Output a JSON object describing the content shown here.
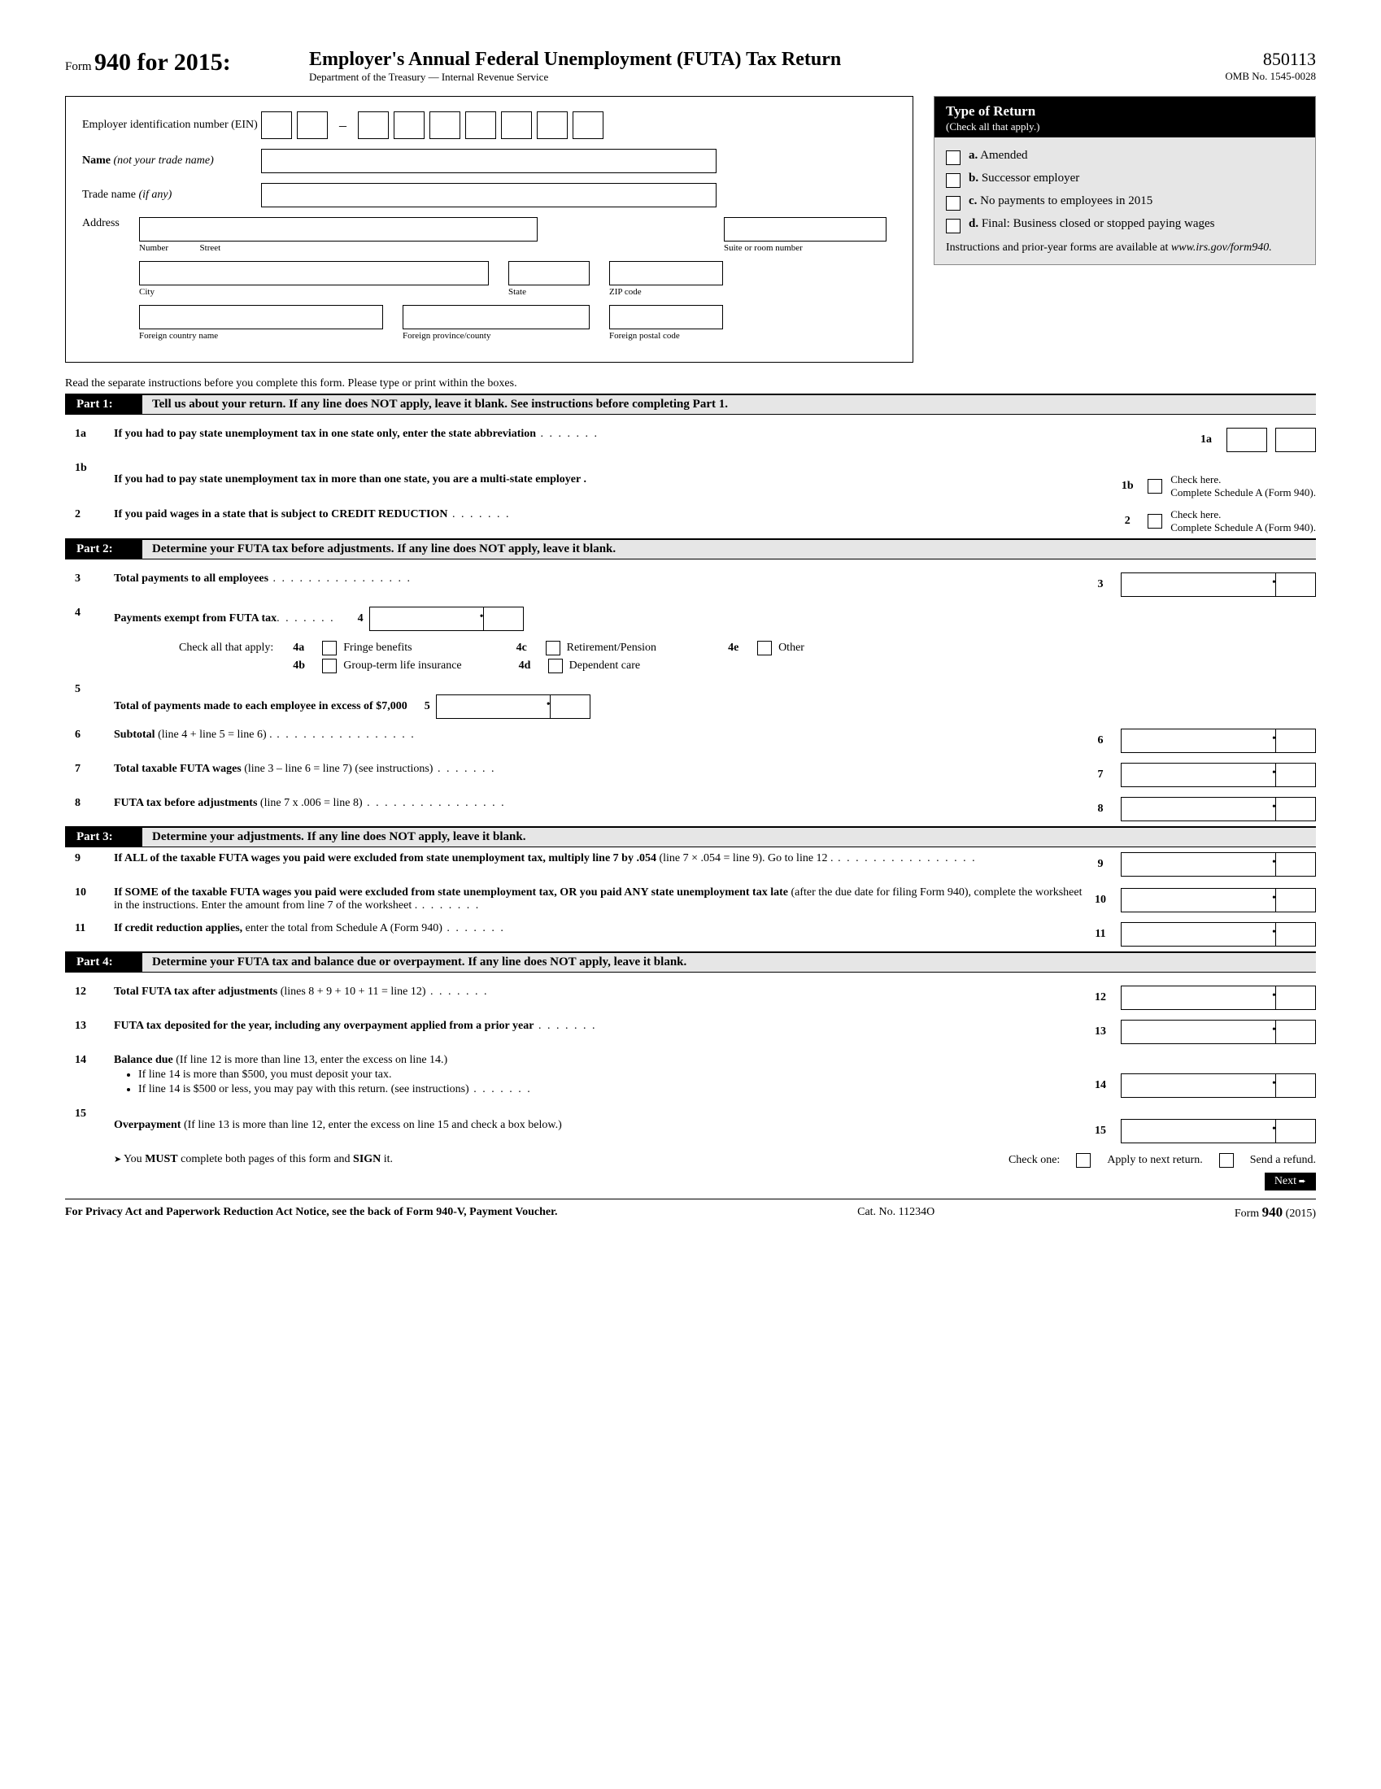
{
  "header": {
    "form_word": "Form",
    "form_number": "940 for 2015:",
    "title": "Employer's Annual Federal Unemployment (FUTA) Tax Return",
    "dept": "Department of the Treasury — Internal Revenue Service",
    "code": "850113",
    "omb": "OMB No. 1545-0028"
  },
  "ein_label": "Employer identification number (EIN)",
  "name_label": "Name",
  "name_hint": "(not your trade name)",
  "trade_label": "Trade name",
  "trade_hint": "(if any)",
  "address_label": "Address",
  "addr": {
    "number": "Number",
    "street": "Street",
    "suite": "Suite or room number",
    "city": "City",
    "state": "State",
    "zip": "ZIP code",
    "fcountry": "Foreign country name",
    "fprov": "Foreign province/county",
    "fpost": "Foreign postal code"
  },
  "tor": {
    "title": "Type of Return",
    "sub": "(Check all that apply.)",
    "a": "a. Amended",
    "b": "b. Successor employer",
    "c": "c. No payments to employees in 2015",
    "d": "d. Final: Business closed or stopped paying wages",
    "note1": "Instructions and prior-year forms are available at ",
    "note2": "www.irs.gov/form940."
  },
  "instruct": "Read the separate instructions before you complete this form. Please type or print within the boxes.",
  "parts": {
    "p1": {
      "label": "Part 1:",
      "title": "Tell us about your return. If any line does NOT apply, leave it blank. See instructions before completing Part 1."
    },
    "p2": {
      "label": "Part 2:",
      "title": "Determine your FUTA tax before adjustments. If any line does NOT apply, leave it blank."
    },
    "p3": {
      "label": "Part 3:",
      "title": "Determine your adjustments. If any line does NOT apply, leave it blank."
    },
    "p4": {
      "label": "Part 4:",
      "title": "Determine your FUTA tax and balance due or overpayment. If any line does NOT apply, leave it blank."
    }
  },
  "lines": {
    "l1a": "If you had to pay state unemployment tax in one state only, enter the state abbreviation",
    "l1b": "If you had to pay state unemployment tax in more than one state, you are a multi-state employer .",
    "l1b_note": "Check here.\nComplete Schedule A (Form 940).",
    "l2": "If you paid wages in a state that is subject to CREDIT REDUCTION",
    "l2_note": "Check here.\nComplete Schedule A (Form 940).",
    "l3": "Total payments to all employees",
    "l4": "Payments exempt from FUTA tax",
    "l4_check": "Check all that apply:",
    "l4a": "Fringe benefits",
    "l4b": "Group-term life insurance",
    "l4c": "Retirement/Pension",
    "l4d": "Dependent care",
    "l4e": "Other",
    "l5": "Total of payments made to each employee in excess of  $7,000",
    "l6b": "Subtotal",
    "l6": " (line 4 + line 5 = line 6) .",
    "l7b": "Total taxable FUTA wages",
    "l7": " (line 3 – line 6 = line 7) (see instructions)",
    "l8b": "FUTA tax before adjustments",
    "l8": " (line 7 x .006 = line 8)",
    "l9a": "If ALL of the taxable FUTA wages you paid were excluded from state unemployment tax,  multiply line 7 by .054",
    "l9b": "  (line 7 × .054 = line 9). Go to line 12 .",
    "l10a": "If SOME of the taxable FUTA wages you paid were excluded from state unemployment tax,  OR you paid ANY state unemployment tax late ",
    "l10b": "(after the due date for filing Form 940), complete the worksheet in the instructions. Enter the amount from line 7 of the worksheet .",
    "l11b": "If credit reduction applies,",
    "l11": " enter the total from Schedule A (Form 940)",
    "l12b": "Total FUTA tax after adjustments",
    "l12": " (lines 8 + 9 + 10 + 11 = line 12)",
    "l13": "FUTA tax deposited for the year, including any overpayment applied from a prior year",
    "l14b": "Balance due",
    "l14": " (If line 12 is more than line 13, enter the excess on line 14.)",
    "l14_b1": "If line 14 is more than $500, you must deposit your tax.",
    "l14_b2": "If line 14 is $500 or less, you may pay with this return. (see instructions)",
    "l15b": "Overpayment",
    "l15": " (If line 13 is more than line 12, enter the excess on line 15 and check a box below.)",
    "l15_must": "You MUST complete both pages of this form and SIGN it.",
    "check_one": "Check one:",
    "apply_next": "Apply to next return.",
    "send_refund": "Send a refund."
  },
  "footer": {
    "privacy": "For Privacy Act and Paperwork Reduction Act Notice, see the back of Form 940-V, Payment Voucher.",
    "cat": "Cat. No. 11234O",
    "form": "Form",
    "formnum": "940",
    "year": "(2015)",
    "next": "Next"
  }
}
